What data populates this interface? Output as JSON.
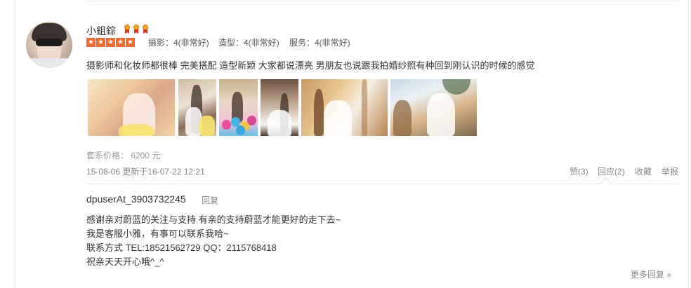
{
  "review": {
    "username": "小鉏錝",
    "stars": 5,
    "scores": [
      {
        "label": "摄影：4(非常好)"
      },
      {
        "label": "造型：4(非常好)"
      },
      {
        "label": "服务：4(非常好)"
      }
    ],
    "comment": "摄影师和化妆师都很棒 完美搭配 造型新颖 大家都说漂亮 男朋友也说跟我拍婚纱照有种回到刚认识的时候的感觉",
    "photo_count": 6,
    "price": "套系价格： 6200 元",
    "meta": "15-08-06  更新于16-07-22 12:21",
    "actions": {
      "like": "赞(3)",
      "reply": "回应(2)",
      "favorite": "收藏",
      "report": "举报"
    }
  },
  "reply": {
    "user": "dpuserAt_3903732245",
    "reply_link": "回复",
    "lines": [
      "感谢亲对蔚蓝的关注与支持 有亲的支持蔚蓝才能更好的走下去~",
      "我是客服小雅，有事可以联系我哈~",
      "联系方式 TEL:18521562729 QQ：2115768418",
      "祝亲天天开心哦^_^"
    ],
    "more": "更多回复 »"
  },
  "colors": {
    "star": "#f26a2e",
    "text": "#333333",
    "muted": "#888888",
    "rule": "#e5e5e5"
  },
  "icons": {
    "medal": "medal-icon",
    "star": "star-icon"
  }
}
